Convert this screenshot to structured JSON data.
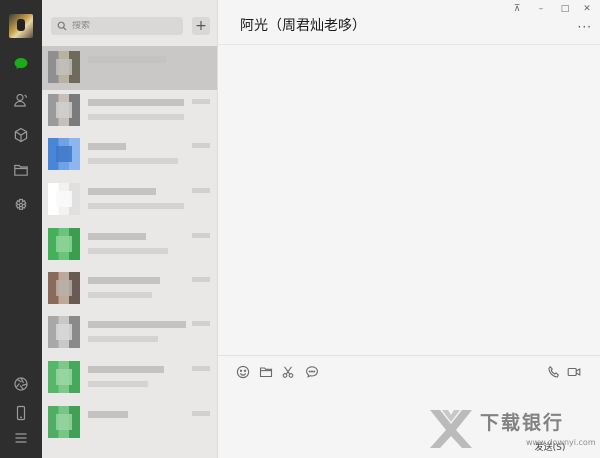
{
  "window": {
    "pin": "⊼",
    "minimize": "–",
    "maximize": "□",
    "close": "✕"
  },
  "nav": {
    "items": [
      {
        "name": "chats",
        "icon": "chat-bubble-icon",
        "active": true
      },
      {
        "name": "contacts",
        "icon": "contacts-icon"
      },
      {
        "name": "favorites",
        "icon": "cube-icon"
      },
      {
        "name": "files",
        "icon": "folder-icon"
      },
      {
        "name": "mini-programs",
        "icon": "mini-program-icon"
      }
    ],
    "bottom": [
      {
        "name": "moments",
        "icon": "aperture-icon"
      },
      {
        "name": "phone",
        "icon": "phone-device-icon"
      },
      {
        "name": "menu",
        "icon": "hamburger-menu-icon"
      }
    ],
    "accent_color": "#1aad19"
  },
  "search": {
    "placeholder": "搜索",
    "add_label": "+"
  },
  "chat": {
    "title": "阿光（周君灿老哆）",
    "more": "···",
    "send_label": "发送(S)"
  },
  "toolbar": {
    "icons": [
      "emoji-icon",
      "folder-icon",
      "scissors-icon",
      "chat-history-icon"
    ],
    "right_icons": [
      "voice-call-icon",
      "video-call-icon"
    ]
  },
  "watermark": {
    "text": "下载银行",
    "url": "www.downyi.com"
  },
  "conversations": [
    {
      "selected": true,
      "avatar_colors": [
        "#8f8f8f",
        "#b9b2a0",
        "#6e6b5e",
        "#c2c0bb"
      ]
    },
    {
      "selected": false,
      "avatar_colors": [
        "#9a9a9a",
        "#c8c0b8",
        "#7b7b7b",
        "#d0d0d0"
      ]
    },
    {
      "selected": false,
      "avatar_colors": [
        "#4a86d8",
        "#6fa2e6",
        "#8db6ee",
        "#3d78c8"
      ]
    },
    {
      "selected": false,
      "avatar_colors": [
        "#ffffff",
        "#f2f2f2",
        "#e0e0e0",
        "#fafafa"
      ]
    },
    {
      "selected": false,
      "avatar_colors": [
        "#45b05a",
        "#6cc47c",
        "#3a9e4e",
        "#8ed39a"
      ]
    },
    {
      "selected": false,
      "avatar_colors": [
        "#8a6b5a",
        "#c0a898",
        "#6a5a54",
        "#b8b0a8"
      ]
    },
    {
      "selected": false,
      "avatar_colors": [
        "#a8a8a8",
        "#c8c8c8",
        "#8a8a8a",
        "#d8d8d8"
      ]
    },
    {
      "selected": false,
      "avatar_colors": [
        "#55b768",
        "#7cc98a",
        "#46a85a",
        "#9bd6a6"
      ]
    },
    {
      "selected": false,
      "avatar_colors": [
        "#4fae63",
        "#78c686",
        "#41a055",
        "#96d3a2"
      ]
    }
  ]
}
